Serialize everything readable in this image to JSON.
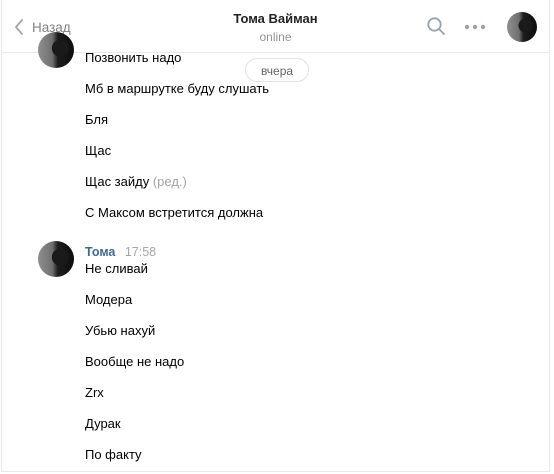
{
  "header": {
    "back_label": "Назад",
    "title": "Тома Вайман",
    "status": "online"
  },
  "date_separator": "вчера",
  "group1": {
    "messages": [
      {
        "text": "Позвонить надо"
      },
      {
        "text": "Мб в маршрутке буду слушать"
      },
      {
        "text": "Бля"
      },
      {
        "text": "Щас"
      },
      {
        "text": "Щас зайду",
        "edited": "(ред.)"
      },
      {
        "text": "С Максом встретится должна"
      }
    ]
  },
  "group2": {
    "author": "Тома",
    "time": "17:58",
    "messages": [
      {
        "text": "Не сливай"
      },
      {
        "text": "Модера"
      },
      {
        "text": "Убью нахуй"
      },
      {
        "text": "Вообще не надо"
      },
      {
        "text": "Zrx"
      },
      {
        "text": "Дурак"
      },
      {
        "text": "По факту"
      }
    ]
  },
  "colors": {
    "link": "#3d6a98",
    "muted": "#939393",
    "border": "#e7e8ec"
  },
  "icons": [
    "chevron-left-icon",
    "search-icon",
    "more-icon"
  ]
}
